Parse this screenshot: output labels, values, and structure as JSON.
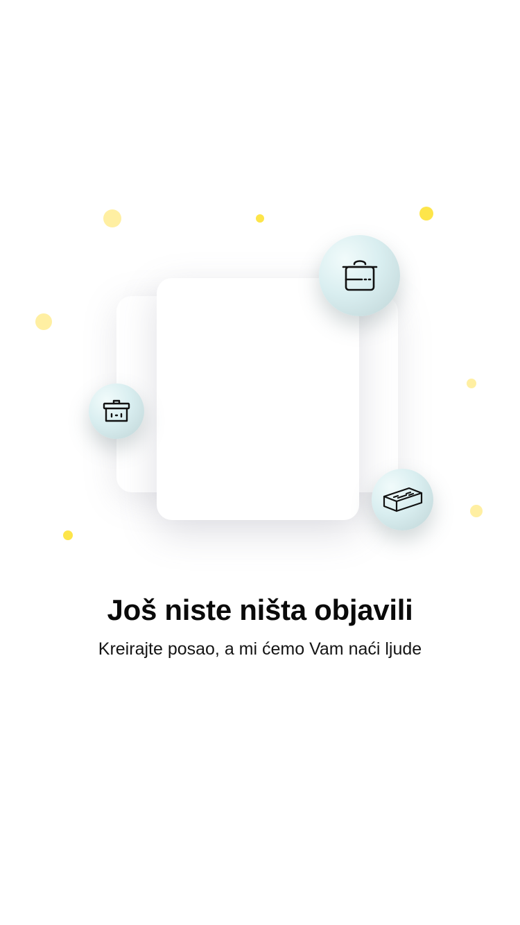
{
  "empty_state": {
    "title": "Još niste ništa objavili",
    "subtitle": "Kreirajte posao, a mi ćemo Vam naći ljude"
  },
  "illustration": {
    "icons": [
      "cooking-pot-icon",
      "basket-icon",
      "brick-icon"
    ],
    "colors": {
      "dot_strong": "#FDE54A",
      "dot_soft": "#FFEFA2",
      "badge_light": "#d9eef0",
      "badge_dark": "#bfd4d6",
      "icon_stroke": "#111111"
    }
  }
}
